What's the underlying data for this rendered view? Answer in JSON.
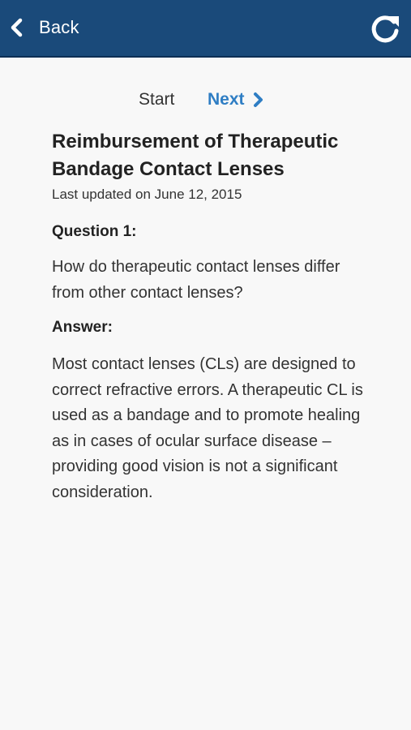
{
  "navbar": {
    "back_label": "Back"
  },
  "pager": {
    "start_label": "Start",
    "next_label": "Next"
  },
  "article": {
    "title": "Reimbursement of Therapeutic Bandage Contact Lenses",
    "updated": "Last updated on June 12, 2015",
    "question_heading": "Question 1:",
    "question_text": "How do therapeutic contact lenses differ from other contact lenses?",
    "answer_heading": "Answer:",
    "answer_text": "Most contact lenses (CLs) are designed to correct refractive errors. A therapeutic CL is used as a bandage and to promote healing as in cases of ocular surface disease – providing good vision is not a significant consideration."
  },
  "colors": {
    "navbar_bg": "#1a4a7a",
    "accent": "#2f7ec4",
    "page_bg": "#f8f8f8"
  },
  "icons": {
    "back": "chevron-left-icon",
    "refresh": "refresh-icon",
    "next": "chevron-right-icon"
  }
}
